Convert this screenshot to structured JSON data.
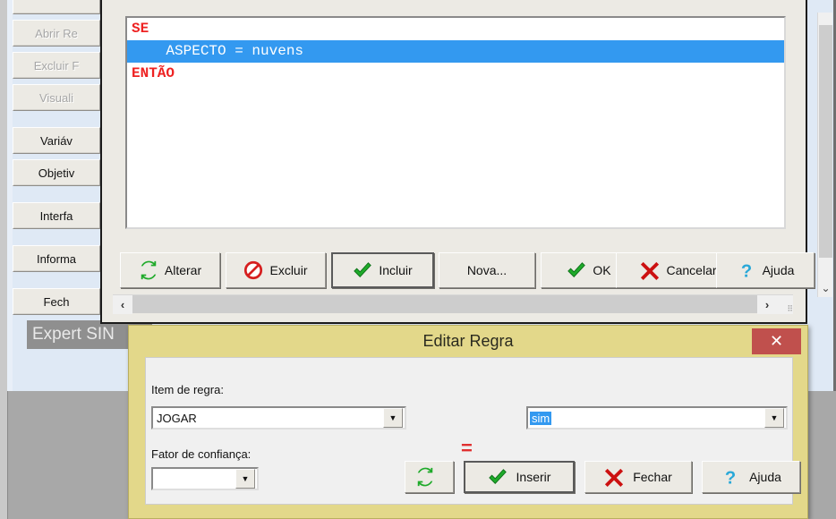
{
  "app": {
    "brand": "Expert SIN"
  },
  "sidebar": {
    "items": [
      {
        "label": "",
        "disabled": true
      },
      {
        "label": "Abrir Re",
        "disabled": true
      },
      {
        "label": "Excluir F",
        "disabled": true
      },
      {
        "label": "Visuali",
        "disabled": true
      },
      {
        "label": "Variáv",
        "disabled": false
      },
      {
        "label": "Objetiv",
        "disabled": false
      },
      {
        "label": "Interfa",
        "disabled": false
      },
      {
        "label": "Informa",
        "disabled": false
      },
      {
        "label": "Fech",
        "disabled": false
      }
    ]
  },
  "editor": {
    "lines": [
      {
        "text": "SE",
        "style": "keyword"
      },
      {
        "text": "    ASPECTO = nuvens",
        "style": "selected"
      },
      {
        "text": "ENTÃO",
        "style": "keyword"
      }
    ]
  },
  "toolbar": {
    "buttons": [
      {
        "label": "Alterar",
        "icon": "refresh-icon"
      },
      {
        "label": "Excluir",
        "icon": "prohibited-icon"
      },
      {
        "label": "Incluir",
        "icon": "check-icon",
        "focused": true
      },
      {
        "label": "Nova...",
        "icon": "none"
      },
      {
        "label": "OK",
        "icon": "check-icon"
      },
      {
        "label": "Cancelar",
        "icon": "cross-icon"
      },
      {
        "label": "Ajuda",
        "icon": "question-icon"
      }
    ]
  },
  "scrollbars": {
    "left_arrow": "‹",
    "right_arrow": "›",
    "down_arrow": "⌄"
  },
  "dialog": {
    "title": "Editar Regra",
    "close_label": "✕",
    "item_label": "Item de regra:",
    "item_value": "JOGAR",
    "operator": "=",
    "value_value": "sim",
    "confidence_label": "Fator de confiança:",
    "confidence_value": "",
    "buttons": [
      {
        "label": "",
        "icon": "refresh-icon"
      },
      {
        "label": "Inserir",
        "icon": "check-icon",
        "focused": true
      },
      {
        "label": "Fechar",
        "icon": "cross-icon"
      },
      {
        "label": "Ajuda",
        "icon": "question-icon"
      }
    ]
  },
  "colors": {
    "dialog_title_bg": "#e3d88a",
    "close_button": "#c0504d",
    "selection": "#3399f0",
    "keyword": "#ee2222",
    "desktop": "#a8a8a8"
  }
}
